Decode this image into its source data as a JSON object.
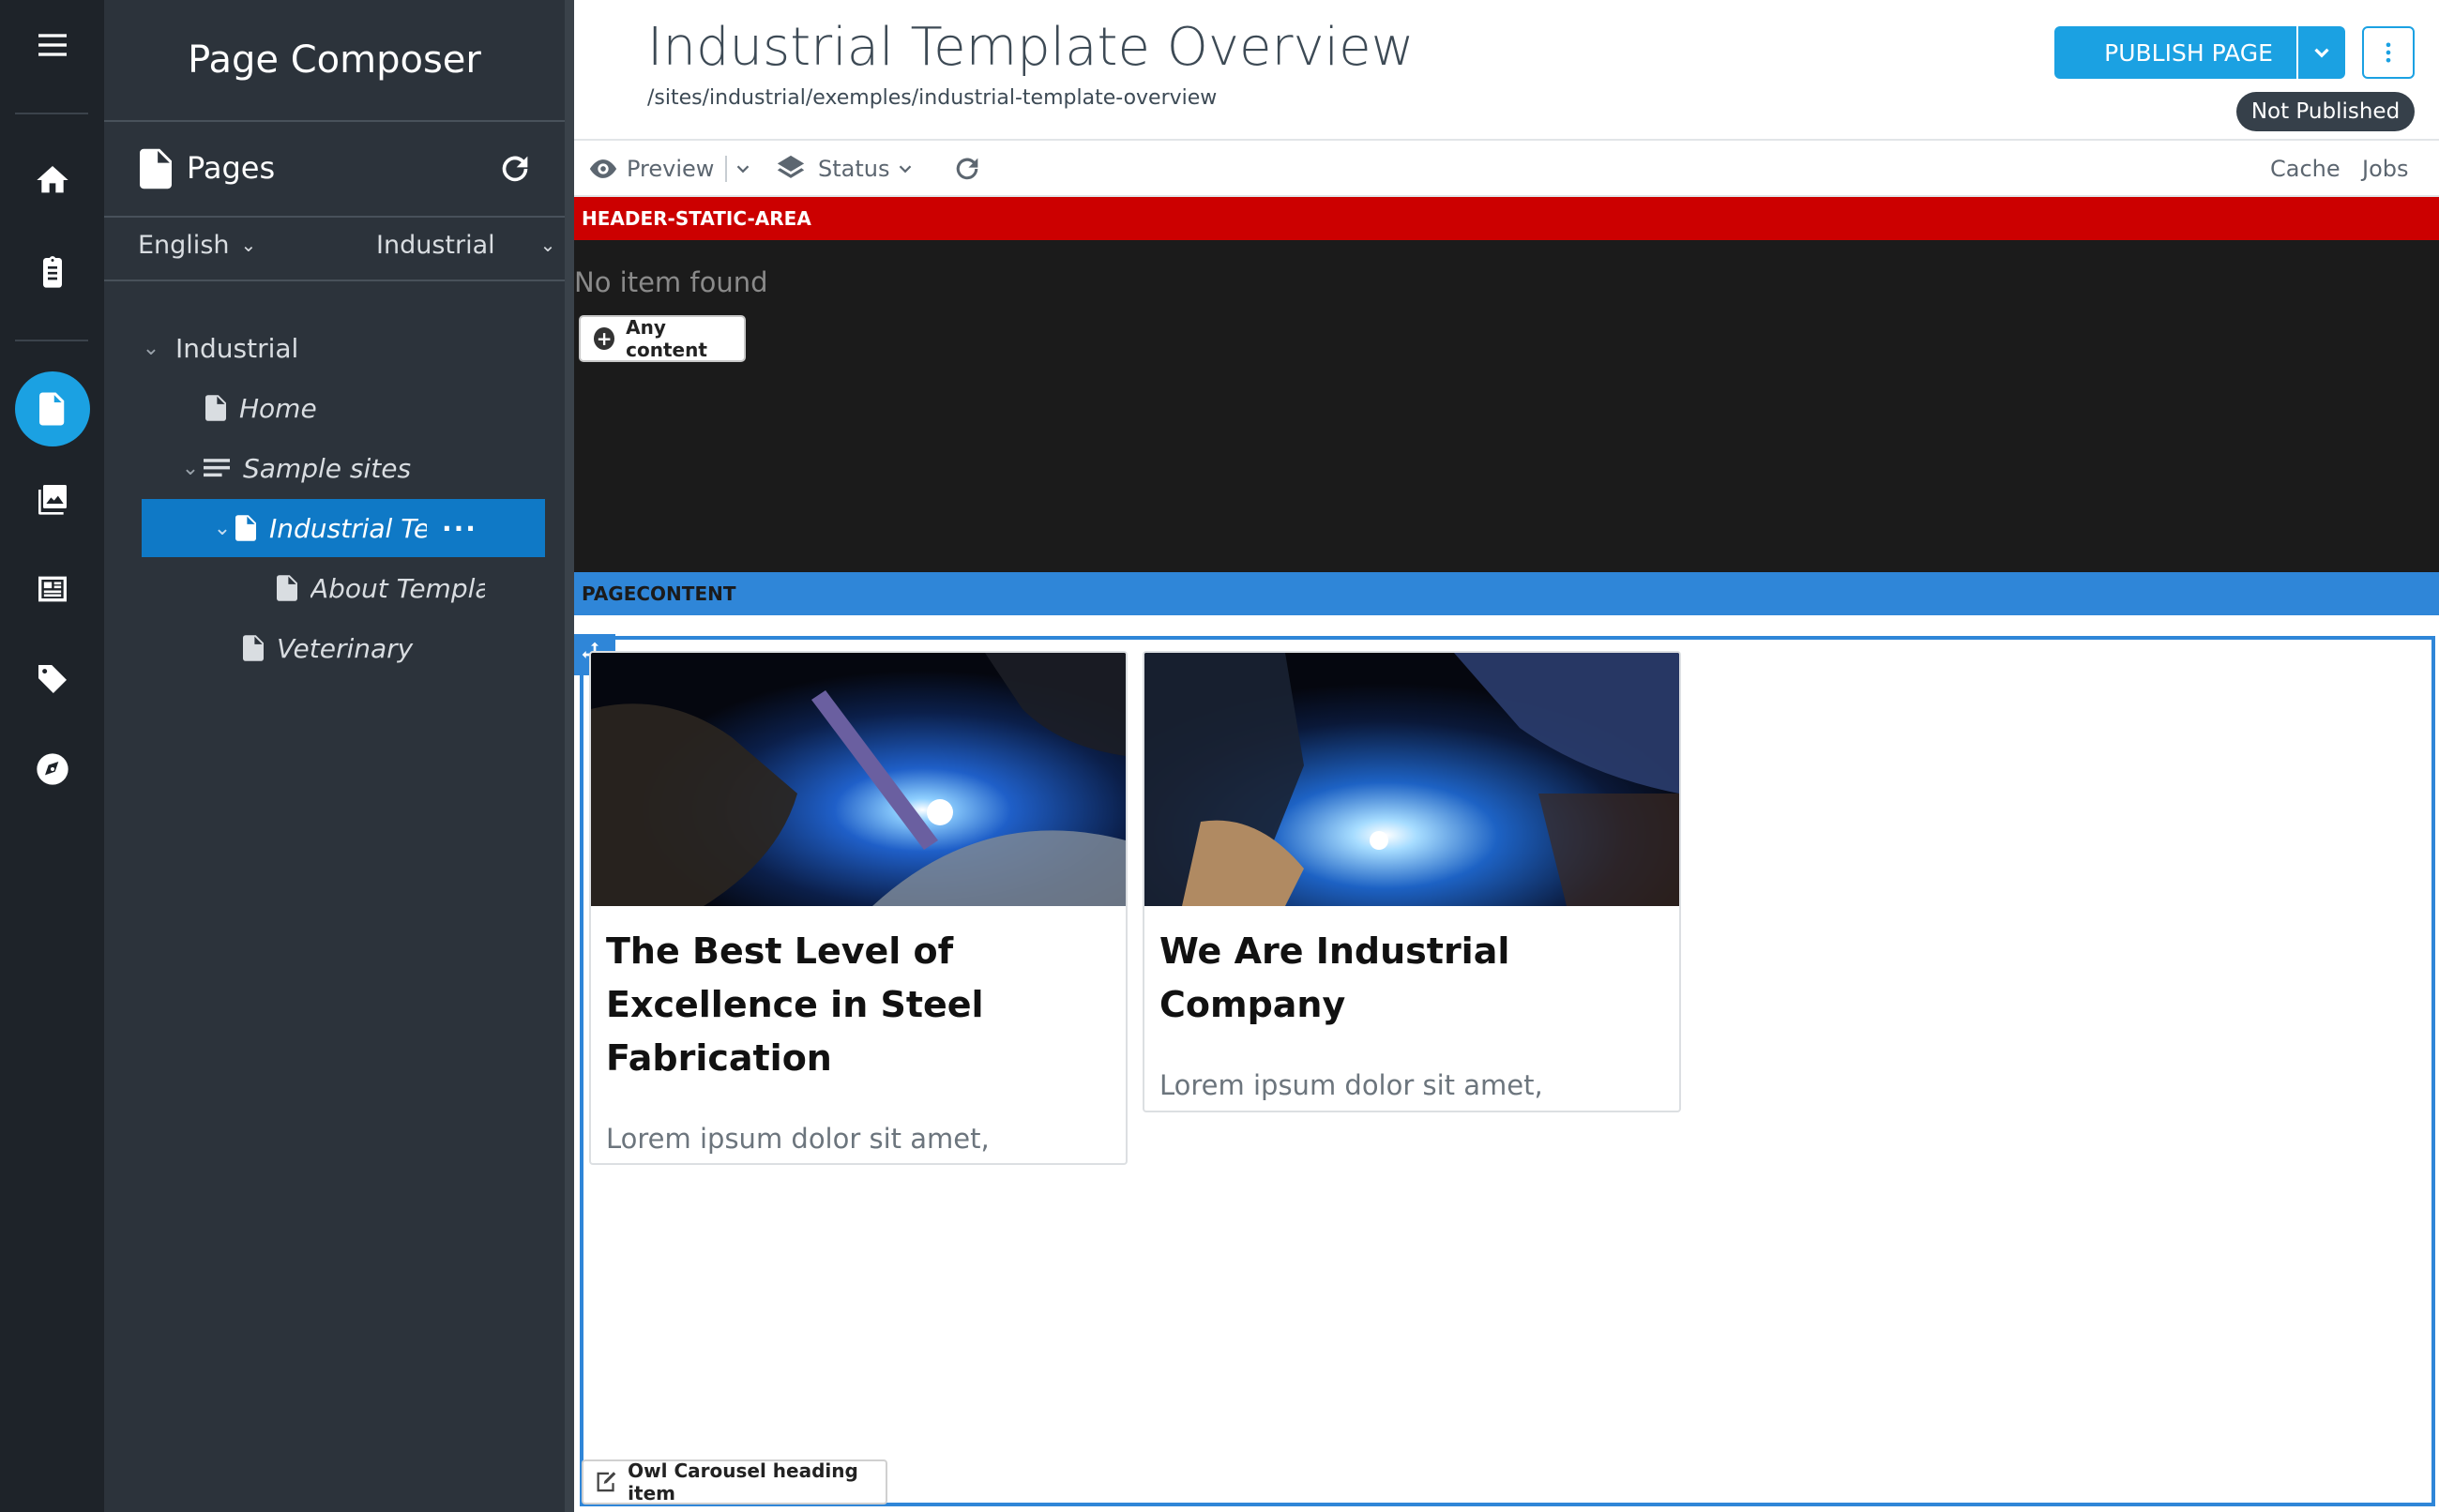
{
  "rail": {
    "icons": [
      "menu-icon",
      "home-icon",
      "clipboard-icon",
      "page-composer-icon",
      "images-icon",
      "content-icon",
      "tag-icon",
      "compass-icon"
    ]
  },
  "panel": {
    "title": "Page Composer",
    "pages_label": "Pages",
    "language": "English",
    "site": "Industrial",
    "tree": [
      {
        "label": "Industrial",
        "level": 0,
        "expanded": true
      },
      {
        "label": "Home",
        "level": 1
      },
      {
        "label": "Sample sites",
        "level": 1,
        "expanded": true
      },
      {
        "label": "Industrial Ten",
        "level": 2,
        "expanded": true,
        "selected": true
      },
      {
        "label": "About Templat",
        "level": 3
      },
      {
        "label": "Veterinary",
        "level": 2
      }
    ]
  },
  "header": {
    "title": "Industrial Template Overview",
    "path": "/sites/industrial/exemples/industrial-template-overview",
    "publish_label": "PUBLISH PAGE",
    "status_badge": "Not Published"
  },
  "toolbar": {
    "preview": "Preview",
    "status": "Status",
    "cache": "Cache",
    "jobs": "Jobs"
  },
  "content": {
    "header_area": "HEADER-STATIC-AREA",
    "no_item": "No item found",
    "any_content": "Any content",
    "pagecontent_area": "PAGECONTENT",
    "cards": [
      {
        "title": "The Best Level of Excellence in Steel Fabrication",
        "text": "Lorem ipsum dolor sit amet, consectetur adipisicing elit. Alias iste ipsa excepturi nostrum sequi molestias?"
      },
      {
        "title": "We Are Industrial Company",
        "text": "Lorem ipsum dolor sit amet, consectetur adipisicing elit. Alias iste ipsa excepturi nostrum sequi molestias?"
      }
    ],
    "owl_item": "Owl Carousel heading item"
  },
  "colors": {
    "rail_bg": "#1e2329",
    "panel_bg": "#2c333b",
    "accent": "#1ba1e2",
    "selected_node": "#0f79c6",
    "header_area": "#cc0000",
    "pagecontent_area": "#2f86d8"
  }
}
